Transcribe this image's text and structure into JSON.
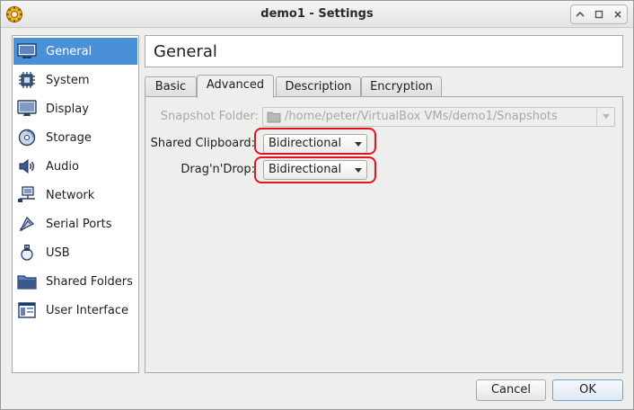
{
  "window": {
    "title": "demo1 - Settings"
  },
  "sidebar": {
    "items": [
      {
        "label": "General",
        "icon": "monitor-icon"
      },
      {
        "label": "System",
        "icon": "chip-icon"
      },
      {
        "label": "Display",
        "icon": "display-icon"
      },
      {
        "label": "Storage",
        "icon": "disk-icon"
      },
      {
        "label": "Audio",
        "icon": "speaker-icon"
      },
      {
        "label": "Network",
        "icon": "network-icon"
      },
      {
        "label": "Serial Ports",
        "icon": "serial-port-icon"
      },
      {
        "label": "USB",
        "icon": "usb-icon"
      },
      {
        "label": "Shared Folders",
        "icon": "folder-icon"
      },
      {
        "label": "User Interface",
        "icon": "ui-window-icon"
      }
    ],
    "selected": "General"
  },
  "page": {
    "title": "General"
  },
  "tabs": [
    {
      "label": "Basic"
    },
    {
      "label": "Advanced"
    },
    {
      "label": "Description"
    },
    {
      "label": "Encryption"
    }
  ],
  "advanced": {
    "snapshot_label": "Snapshot Folder:",
    "snapshot_path": "/home/peter/VirtualBox VMs/demo1/Snapshots",
    "clipboard_label": "Shared Clipboard:",
    "clipboard_value": "Bidirectional",
    "dnd_label": "Drag'n'Drop:",
    "dnd_value": "Bidirectional"
  },
  "buttons": {
    "cancel": "Cancel",
    "ok": "OK"
  },
  "colors": {
    "selection": "#4a90d9",
    "highlight_ring": "#e0141b"
  }
}
